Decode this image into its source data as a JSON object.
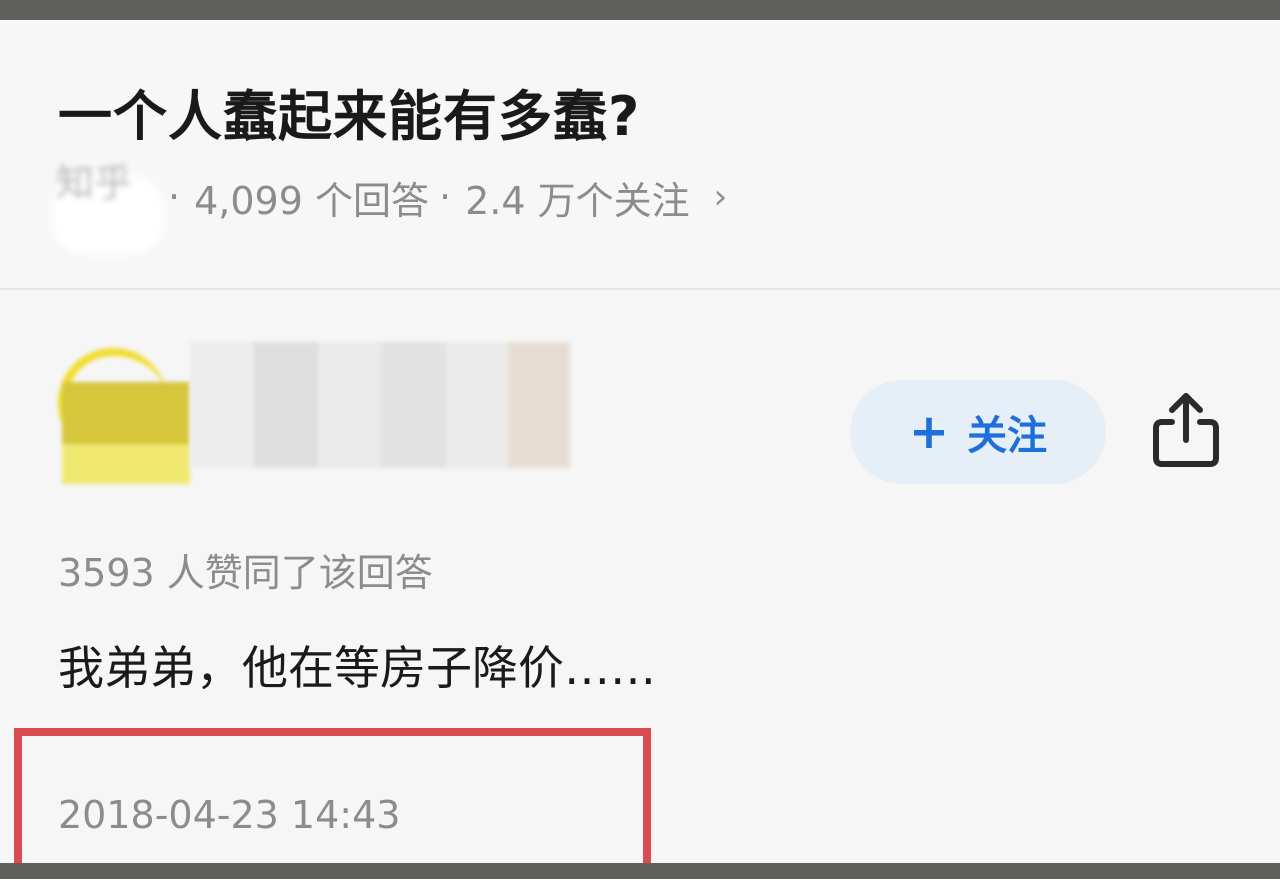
{
  "question": {
    "title": "一个人蠢起来能有多蠢?",
    "topic_ghost": "知乎",
    "answers_count": "4,099 个回答",
    "followers_count": "2.4 万个关注",
    "separator": "·",
    "chevron": "›"
  },
  "answer": {
    "follow_label": "关注",
    "follow_plus": "+",
    "likes_text": "3593 人赞同了该回答",
    "content": "我弟弟，他在等房子降价……",
    "timestamp": "2018-04-23 14:43"
  },
  "icons": {
    "share": "share-icon",
    "chevron": "chevron-right-icon",
    "plus": "plus-icon"
  },
  "colors": {
    "accent_blue": "#1e6fd9",
    "follow_bg": "#e6eef8",
    "highlight_red": "#d84c52",
    "text_primary": "#1a1a1a",
    "text_secondary": "#8c8c8c",
    "avatar_yellow": "#f1dc2c"
  }
}
